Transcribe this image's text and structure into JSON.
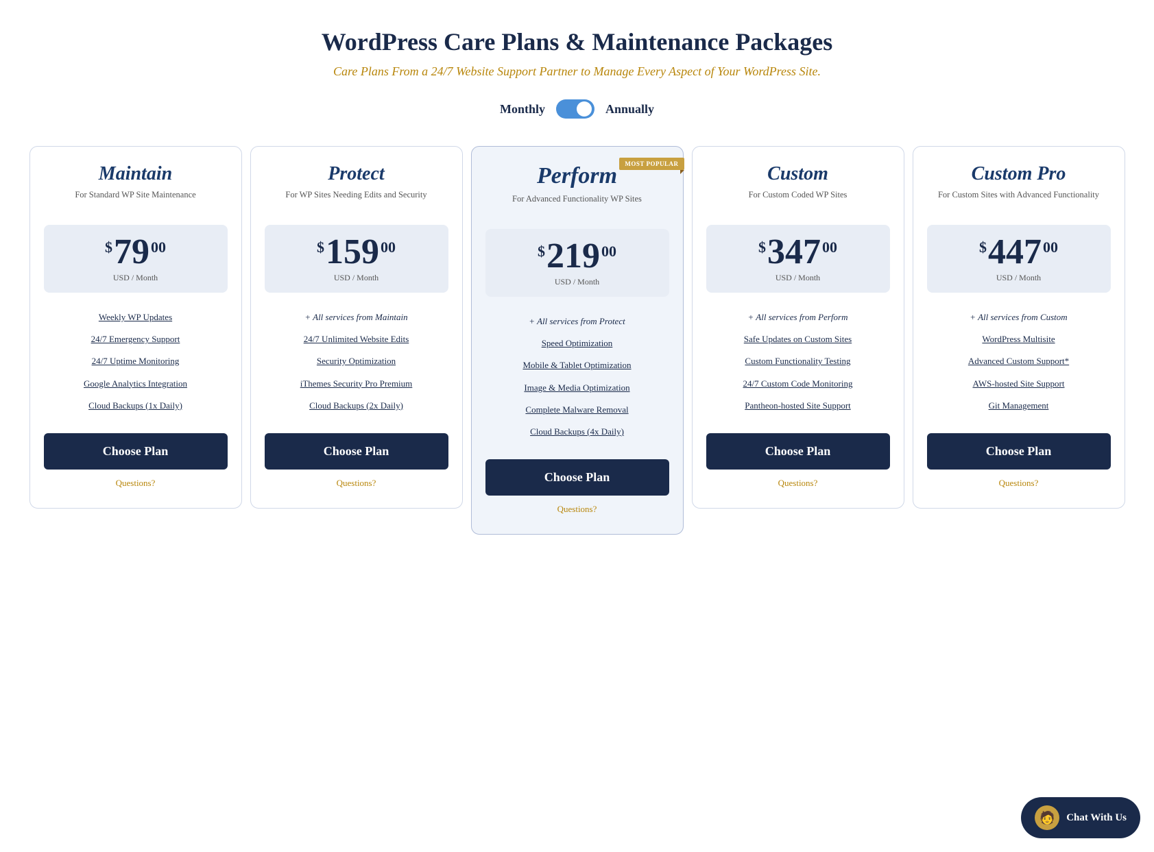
{
  "header": {
    "title": "WordPress Care Plans & Maintenance Packages",
    "subtitle": "Care Plans From a 24/7 Website Support Partner to Manage Every Aspect of Your WordPress Site."
  },
  "toggle": {
    "monthly_label": "Monthly",
    "annually_label": "Annually",
    "state": "annually"
  },
  "plans": [
    {
      "id": "maintain",
      "name": "Maintain",
      "name_size": "normal",
      "desc": "For Standard WP Site Maintenance",
      "price_dollar": "$",
      "price_amount": "79",
      "price_cents": "00",
      "price_period": "USD / Month",
      "most_popular": false,
      "highlighted": false,
      "features": [
        {
          "text": "Weekly WP Updates",
          "underlined": true
        },
        {
          "text": "24/7 Emergency Support",
          "underlined": true
        },
        {
          "text": "24/7 Uptime Monitoring",
          "underlined": true
        },
        {
          "text": "Google Analytics Integration",
          "underlined": true
        },
        {
          "text": "Cloud Backups (1x Daily)",
          "underlined": true
        }
      ],
      "cta_label": "Choose Plan",
      "questions_label": "Questions?"
    },
    {
      "id": "protect",
      "name": "Protect",
      "name_size": "normal",
      "desc": "For WP Sites Needing Edits and Security",
      "price_dollar": "$",
      "price_amount": "159",
      "price_cents": "00",
      "price_period": "USD / Month",
      "most_popular": false,
      "highlighted": false,
      "features": [
        {
          "text": "+ All services from Maintain",
          "underlined": false
        },
        {
          "text": "24/7 Unlimited Website Edits",
          "underlined": true
        },
        {
          "text": "Security Optimization",
          "underlined": true
        },
        {
          "text": "iThemes Security Pro Premium",
          "underlined": true
        },
        {
          "text": "Cloud Backups (2x Daily)",
          "underlined": true
        }
      ],
      "cta_label": "Choose Plan",
      "questions_label": "Questions?"
    },
    {
      "id": "perform",
      "name": "Perform",
      "name_size": "larger",
      "desc": "For Advanced Functionality WP Sites",
      "price_dollar": "$",
      "price_amount": "219",
      "price_cents": "00",
      "price_period": "USD / Month",
      "most_popular": true,
      "most_popular_label": "MOST POPULAR",
      "highlighted": true,
      "features": [
        {
          "text": "+ All services from Protect",
          "underlined": false
        },
        {
          "text": "Speed Optimization",
          "underlined": true
        },
        {
          "text": "Mobile & Tablet Optimization",
          "underlined": true
        },
        {
          "text": "Image & Media Optimization",
          "underlined": true
        },
        {
          "text": "Complete Malware Removal",
          "underlined": true
        },
        {
          "text": "Cloud Backups (4x Daily)",
          "underlined": true
        }
      ],
      "cta_label": "Choose Plan",
      "questions_label": "Questions?"
    },
    {
      "id": "custom",
      "name": "Custom",
      "name_size": "normal",
      "desc": "For Custom Coded WP Sites",
      "price_dollar": "$",
      "price_amount": "347",
      "price_cents": "00",
      "price_period": "USD / Month",
      "most_popular": false,
      "highlighted": false,
      "features": [
        {
          "text": "+ All services from Perform",
          "underlined": false
        },
        {
          "text": "Safe Updates on Custom Sites",
          "underlined": true
        },
        {
          "text": "Custom Functionality Testing",
          "underlined": true
        },
        {
          "text": "24/7 Custom Code Monitoring",
          "underlined": true
        },
        {
          "text": "Pantheon-hosted Site Support",
          "underlined": true
        }
      ],
      "cta_label": "Choose Plan",
      "questions_label": "Questions?"
    },
    {
      "id": "custom-pro",
      "name": "Custom Pro",
      "name_size": "normal",
      "desc": "For Custom Sites with Advanced Functionality",
      "price_dollar": "$",
      "price_amount": "447",
      "price_cents": "00",
      "price_period": "USD / Month",
      "most_popular": false,
      "highlighted": false,
      "features": [
        {
          "text": "+ All services from Custom",
          "underlined": false
        },
        {
          "text": "WordPress Multisite",
          "underlined": true
        },
        {
          "text": "Advanced Custom Support*",
          "underlined": true
        },
        {
          "text": "AWS-hosted Site Support",
          "underlined": true
        },
        {
          "text": "Git Management",
          "underlined": true
        }
      ],
      "cta_label": "Choose Plan",
      "questions_label": "Questions?",
      "has_chat": true
    }
  ],
  "chat_widget": {
    "label": "Chat With Us"
  }
}
